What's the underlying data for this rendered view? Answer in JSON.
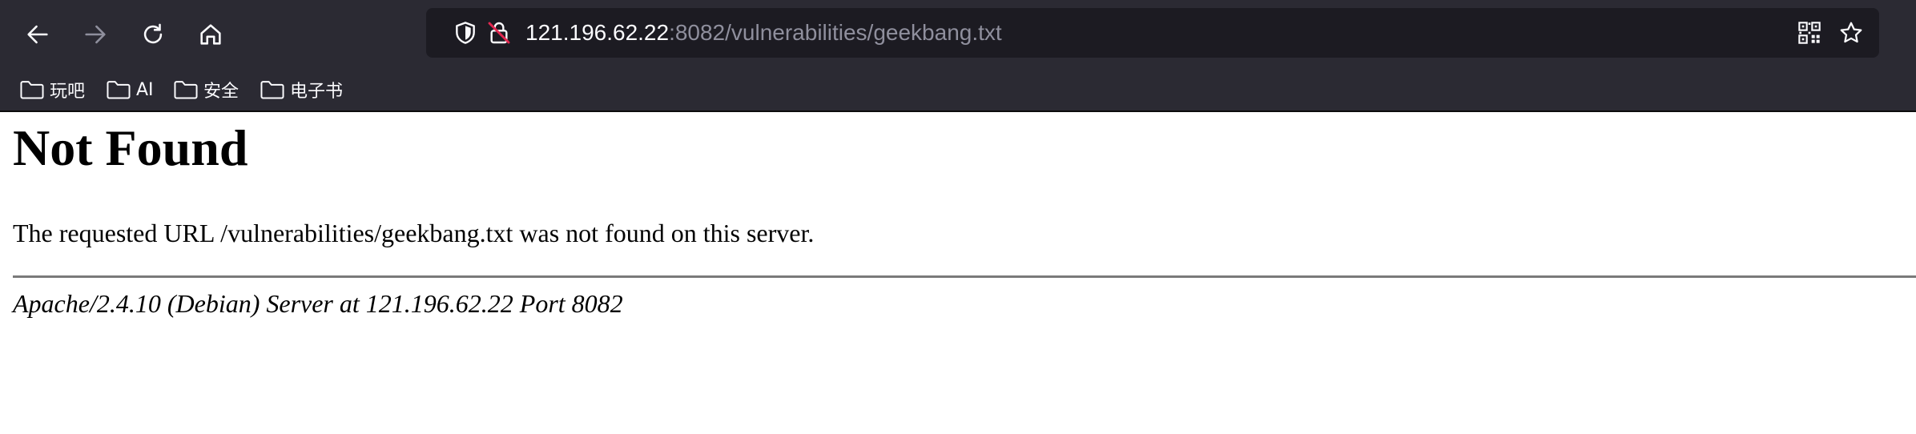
{
  "browser": {
    "back_icon": "arrow-left",
    "forward_icon": "arrow-right",
    "reload_icon": "reload",
    "home_icon": "home",
    "url_host": "121.196.62.22",
    "url_rest": ":8082/vulnerabilities/geekbang.txt",
    "shield_icon": "shield",
    "insecure_lock_icon": "lock-with-strike",
    "qr_icon": "qr-code",
    "bookmark_star_icon": "star"
  },
  "bookmarks": [
    {
      "label": "玩吧",
      "icon": "folder"
    },
    {
      "label": "AI",
      "icon": "folder"
    },
    {
      "label": "安全",
      "icon": "folder"
    },
    {
      "label": "电子书",
      "icon": "folder"
    }
  ],
  "page": {
    "heading": "Not Found",
    "message": "The requested URL /vulnerabilities/geekbang.txt was not found on this server.",
    "address": "Apache/2.4.10 (Debian) Server at 121.196.62.22 Port 8082"
  },
  "colors": {
    "chrome_bg": "#2b2a33",
    "urlbar_bg": "#1c1b22",
    "icon_color": "#fbfbfe",
    "disabled_icon": "#8f8f9d",
    "insecure_red": "#e22850"
  }
}
